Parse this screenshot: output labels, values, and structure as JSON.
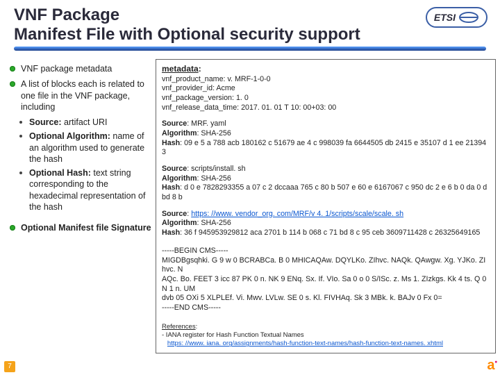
{
  "header": {
    "title_line1": "VNF Package",
    "title_line2": "Manifest File with Optional security support",
    "logo_text": "ETSI"
  },
  "left": {
    "item1": "VNF package metadata",
    "item2": "A list of blocks each is related to one file in the VNF package, including",
    "sub1_label": "Source:",
    "sub1_text": " artifact URI",
    "sub2_label": "Optional Algorithm:",
    "sub2_text": " name of an algorithm used to generate the hash",
    "sub3_label": "Optional Hash:",
    "sub3_text": " text string corresponding to the hexadecimal representation of the hash",
    "item3": "Optional Manifest file Signature"
  },
  "meta": {
    "heading": "metadata",
    "product": "vnf_product_name: v. MRF-1-0-0",
    "provider": "vnf_provider_id: Acme",
    "version": "vnf_package_version: 1. 0",
    "release": "vnf_release_data_time: 2017. 01. 01 T 10: 00+03: 00"
  },
  "b1": {
    "src_label": "Source",
    "src": ": MRF. yaml",
    "alg_label": "Algorithm",
    "alg": ": SHA-256",
    "hash_label": "Hash",
    "hash": ": 09 e 5 a 788 acb 180162 c 51679 ae 4 c 998039 fa 6644505 db 2415 e 35107 d 1 ee 213943"
  },
  "b2": {
    "src_label": "Source",
    "src": ": scripts/install. sh",
    "alg_label": "Algorithm",
    "alg": ": SHA-256",
    "hash_label": "Hash",
    "hash": ": d 0 e 7828293355 a 07 c 2 dccaaa 765 c 80 b 507 e 60 e 6167067 c 950 dc 2 e 6 b 0 da 0 dbd 8 b"
  },
  "b3": {
    "src_label": "Source",
    "src_pre": ": ",
    "src_link": "https: //www. vendor_org. com/MRF/v 4. 1/scripts/scale/scale. sh",
    "alg_label": "Algorithm",
    "alg": ": SHA-256",
    "hash_label": "Hash",
    "hash": ": 36 f 945953929812 aca 2701 b 114 b 068 c 71 bd 8 c 95 ceb 3609711428 c 26325649165"
  },
  "cms": {
    "begin": "-----BEGIN CMS-----",
    "l1": "MIGDBgsqhki. G 9 w 0 BCRABCa. B 0 MHICAQAw. DQYLKo. ZIhvc. NAQk. QAwgw. Xg. YJKo. ZIhvc. N",
    "l2": "AQc. Bo. FEET 3 icc 87 PK 0 n. NK 9 ENq. Sx. If. VIo. Sa 0 o 0 S/ISc. z. Ms 1. ZIzkgs. Kk 4 ts. Q 0 N 1 n. UM",
    "l3": "dvb 05 OXi 5 XLPLEf. Vi. Mwv. LVLw. SE 0 s. Kl. FIVHAq. Sk 3 MBk. k. BAJv 0 Fx 0=",
    "end": "-----END CMS-----"
  },
  "refs": {
    "heading": "References",
    "colon": ":",
    "item1": "-  IANA register for Hash Function Textual Names",
    "link": "https: //www. iana. org/assignments/hash-function-text-names/hash-function-text-names. xhtml"
  },
  "footer": {
    "page": "7",
    "a": "a"
  }
}
